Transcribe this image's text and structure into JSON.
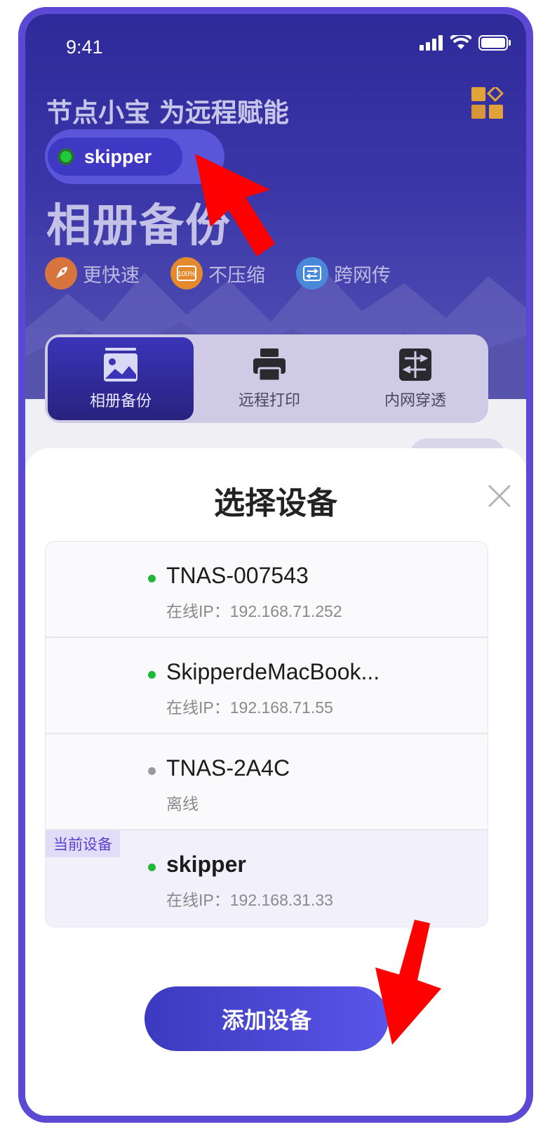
{
  "status_bar": {
    "time": "9:41"
  },
  "header": {
    "slogan": "节点小宝 为远程赋能",
    "current_device": "skipper",
    "page_title": "相册备份",
    "features": [
      {
        "icon": "rocket-icon",
        "label": "更快速",
        "color": "#d8743d"
      },
      {
        "icon": "hundred-percent-icon",
        "label": "不压缩",
        "color": "#e48a2c"
      },
      {
        "icon": "transfer-icon",
        "label": "跨网传",
        "color": "#4a88d9"
      }
    ]
  },
  "tabs": [
    {
      "icon": "photo-icon",
      "label": "相册备份",
      "active": true
    },
    {
      "icon": "printer-icon",
      "label": "远程打印",
      "active": false
    },
    {
      "icon": "tunnel-icon",
      "label": "内网穿透",
      "active": false
    }
  ],
  "sheet": {
    "title": "选择设备",
    "current_tag": "当前设备",
    "devices": [
      {
        "name": "TNAS-007543",
        "sub": "在线IP：192.168.71.252",
        "status": "online",
        "dot_color": "#1fb83a"
      },
      {
        "name": "SkipperdeMacBook...",
        "sub": "在线IP：192.168.71.55",
        "status": "online",
        "dot_color": "#1fb83a"
      },
      {
        "name": "TNAS-2A4C",
        "sub": "离线",
        "status": "offline",
        "dot_color": "#9a9a9a"
      },
      {
        "name": "skipper",
        "sub": "在线IP：192.168.31.33",
        "status": "online",
        "dot_color": "#1fb83a",
        "current": true
      }
    ],
    "add_button": "添加设备"
  },
  "colors": {
    "frame": "#5b49d6",
    "accent": "#4a44d8",
    "annotation_arrow": "#ff0000"
  }
}
